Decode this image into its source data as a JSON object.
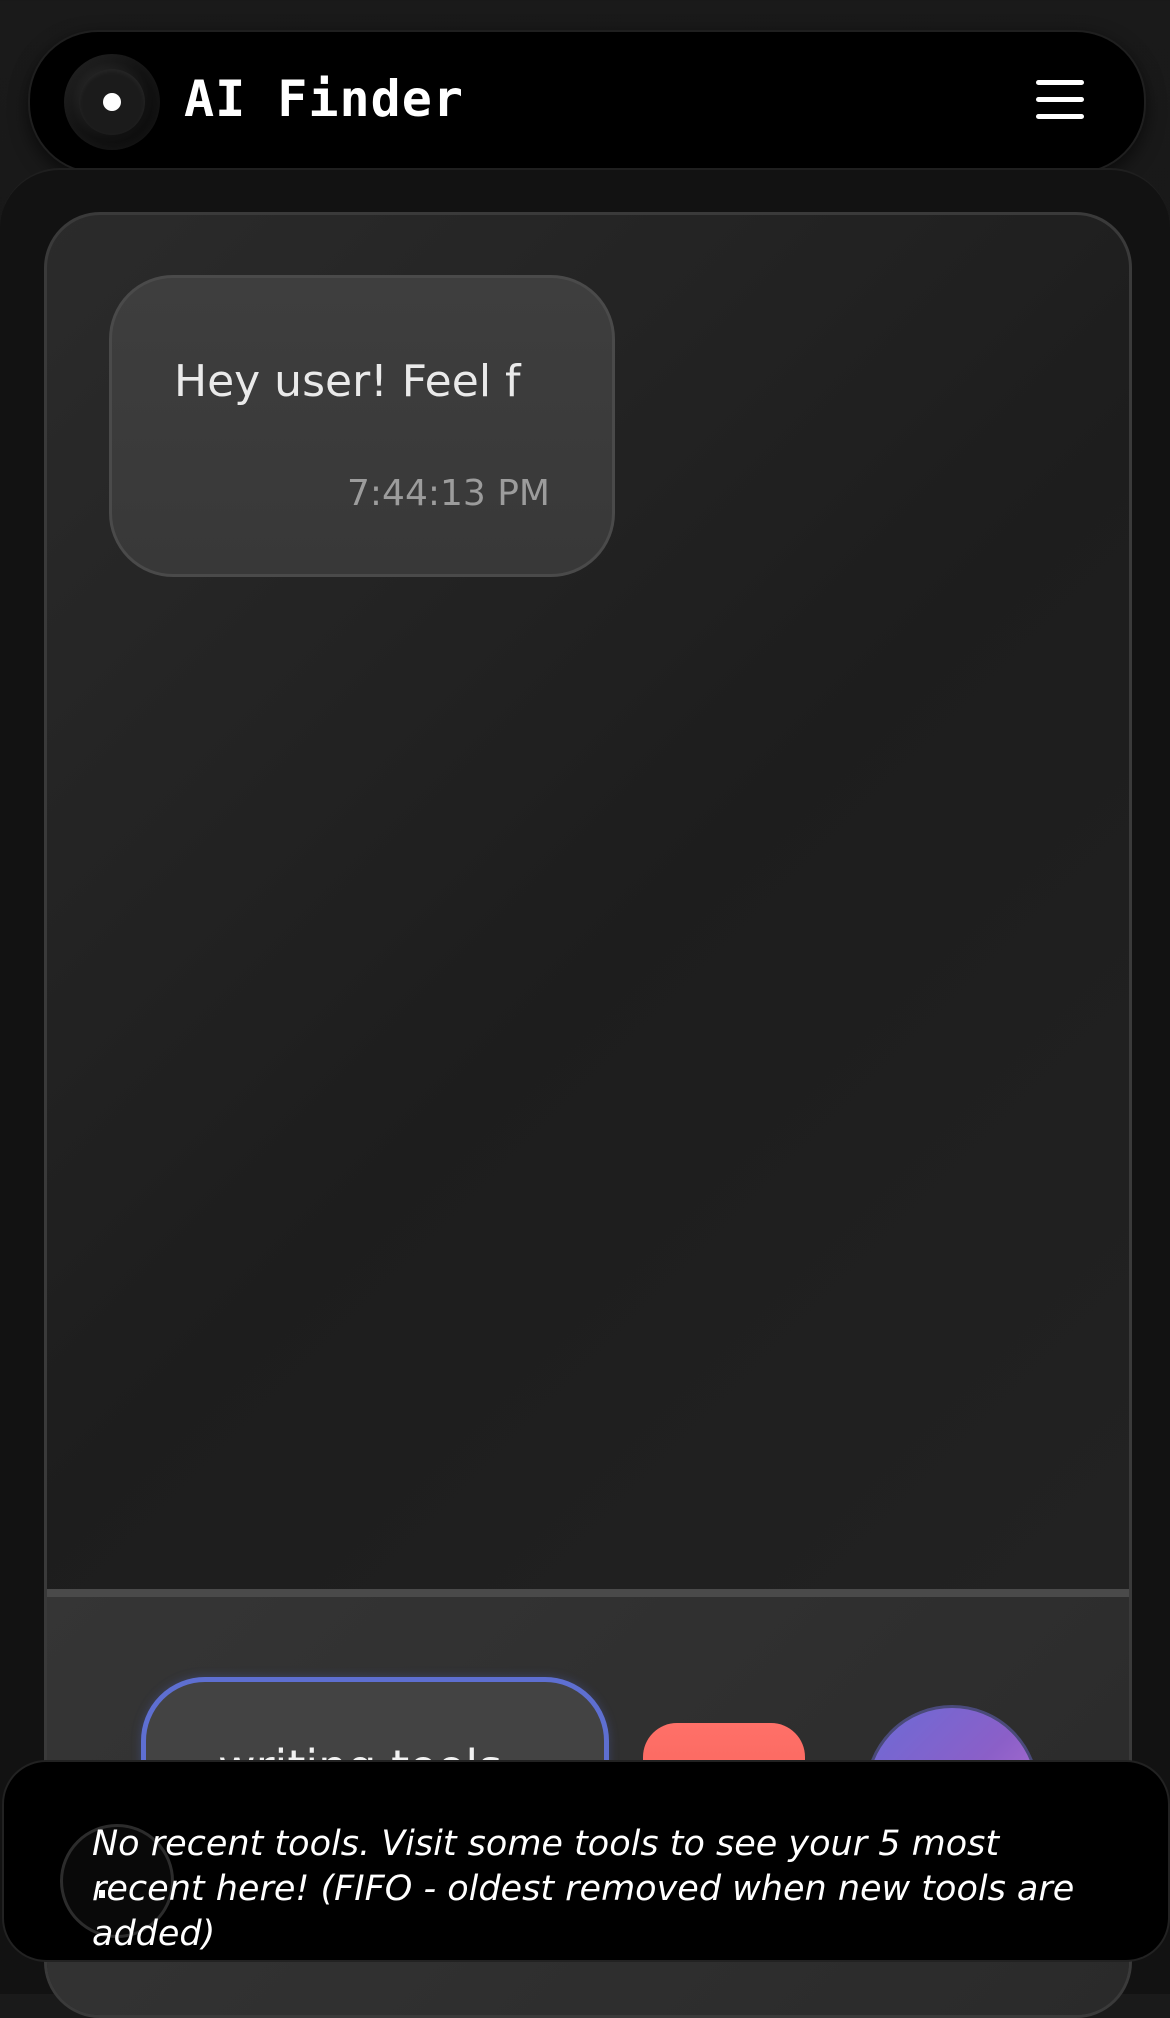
{
  "header": {
    "app_title": "AI Finder",
    "logo_icon": "record-dot-icon",
    "menu_icon": "hamburger-menu-icon"
  },
  "chat": {
    "messages": [
      {
        "text": "Hey user! Feel f",
        "time": "7:44:13 PM"
      }
    ]
  },
  "input": {
    "value": "writing tools",
    "red_button_icon": "alert-bell-icon",
    "send_button_icon": "upload-arrow-icon"
  },
  "recent_tools": {
    "empty_text": "No recent tools. Visit some tools to see your 5 most recent here! (FIFO - oldest removed when new tools are added)"
  },
  "colors": {
    "accent_blue": "#5e6fd1",
    "red_button": "#ff7068",
    "purple_gradient_start": "#6b6bd6",
    "purple_gradient_end": "#c37ad8"
  }
}
